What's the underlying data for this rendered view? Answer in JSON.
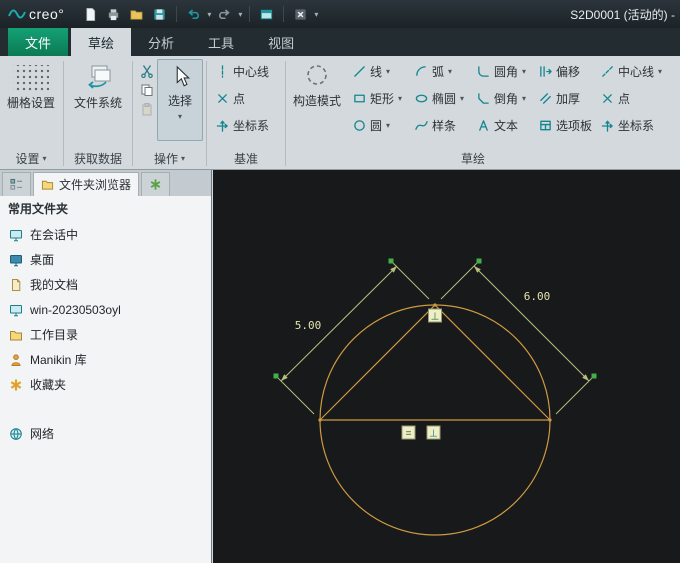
{
  "titlebar": {
    "logo_text": "creo°",
    "title": "S2D0001 (活动的) -"
  },
  "tabs": {
    "file": "文件",
    "sketch": "草绘",
    "analysis": "分析",
    "tools": "工具",
    "view": "视图"
  },
  "ribbon": {
    "grid_settings_label": "栅格设置",
    "settings_footer": "设置",
    "file_system_label": "文件系统",
    "get_data_footer": "获取数据",
    "select_label": "选择",
    "operations_footer": "操作",
    "datum_items": [
      {
        "label": "中心线",
        "icon": "centerline_v"
      },
      {
        "label": "点",
        "icon": "point"
      },
      {
        "label": "坐标系",
        "icon": "csys"
      }
    ],
    "datum_footer": "基准",
    "construction_label": "构造模式",
    "sketch_tools": [
      {
        "label": "线",
        "icon": "line",
        "arrow": true
      },
      {
        "label": "矩形",
        "icon": "rect",
        "arrow": true
      },
      {
        "label": "圆",
        "icon": "circle",
        "arrow": true
      },
      {
        "label": "弧",
        "icon": "arc",
        "arrow": true
      },
      {
        "label": "椭圆",
        "icon": "ellipse",
        "arrow": true
      },
      {
        "label": "样条",
        "icon": "spline",
        "arrow": false
      },
      {
        "label": "圆角",
        "icon": "fillet",
        "arrow": true
      },
      {
        "label": "倒角",
        "icon": "chamfer",
        "arrow": true
      },
      {
        "label": "文本",
        "icon": "text",
        "arrow": false
      },
      {
        "label": "偏移",
        "icon": "offset",
        "arrow": false
      },
      {
        "label": "加厚",
        "icon": "thicken",
        "arrow": false
      },
      {
        "label": "选项板",
        "icon": "palette",
        "arrow": false
      },
      {
        "label": "中心线",
        "icon": "centerline",
        "arrow": true
      },
      {
        "label": "点",
        "icon": "point",
        "arrow": false
      },
      {
        "label": "坐标系",
        "icon": "csys",
        "arrow": false
      }
    ],
    "sketch_footer": "草绘"
  },
  "panel": {
    "browser_tab": "文件夹浏览器",
    "header": "常用文件夹",
    "folders": [
      {
        "label": "在会话中",
        "icon": "monitor"
      },
      {
        "label": "桌面",
        "icon": "desktop"
      },
      {
        "label": "我的文档",
        "icon": "documents"
      },
      {
        "label": "win-20230503oyl",
        "icon": "computer"
      },
      {
        "label": "工作目录",
        "icon": "folder"
      },
      {
        "label": "Manikin 库",
        "icon": "library"
      },
      {
        "label": "收藏夹",
        "icon": "favorites"
      },
      {
        "label": "网络",
        "icon": "network",
        "gap_before": true
      }
    ]
  },
  "canvas": {
    "dim_left": "5.00",
    "dim_right": "6.00",
    "apex_constraint": "⊥",
    "equal_constraint": "=",
    "mid_constraint": "⊥"
  }
}
